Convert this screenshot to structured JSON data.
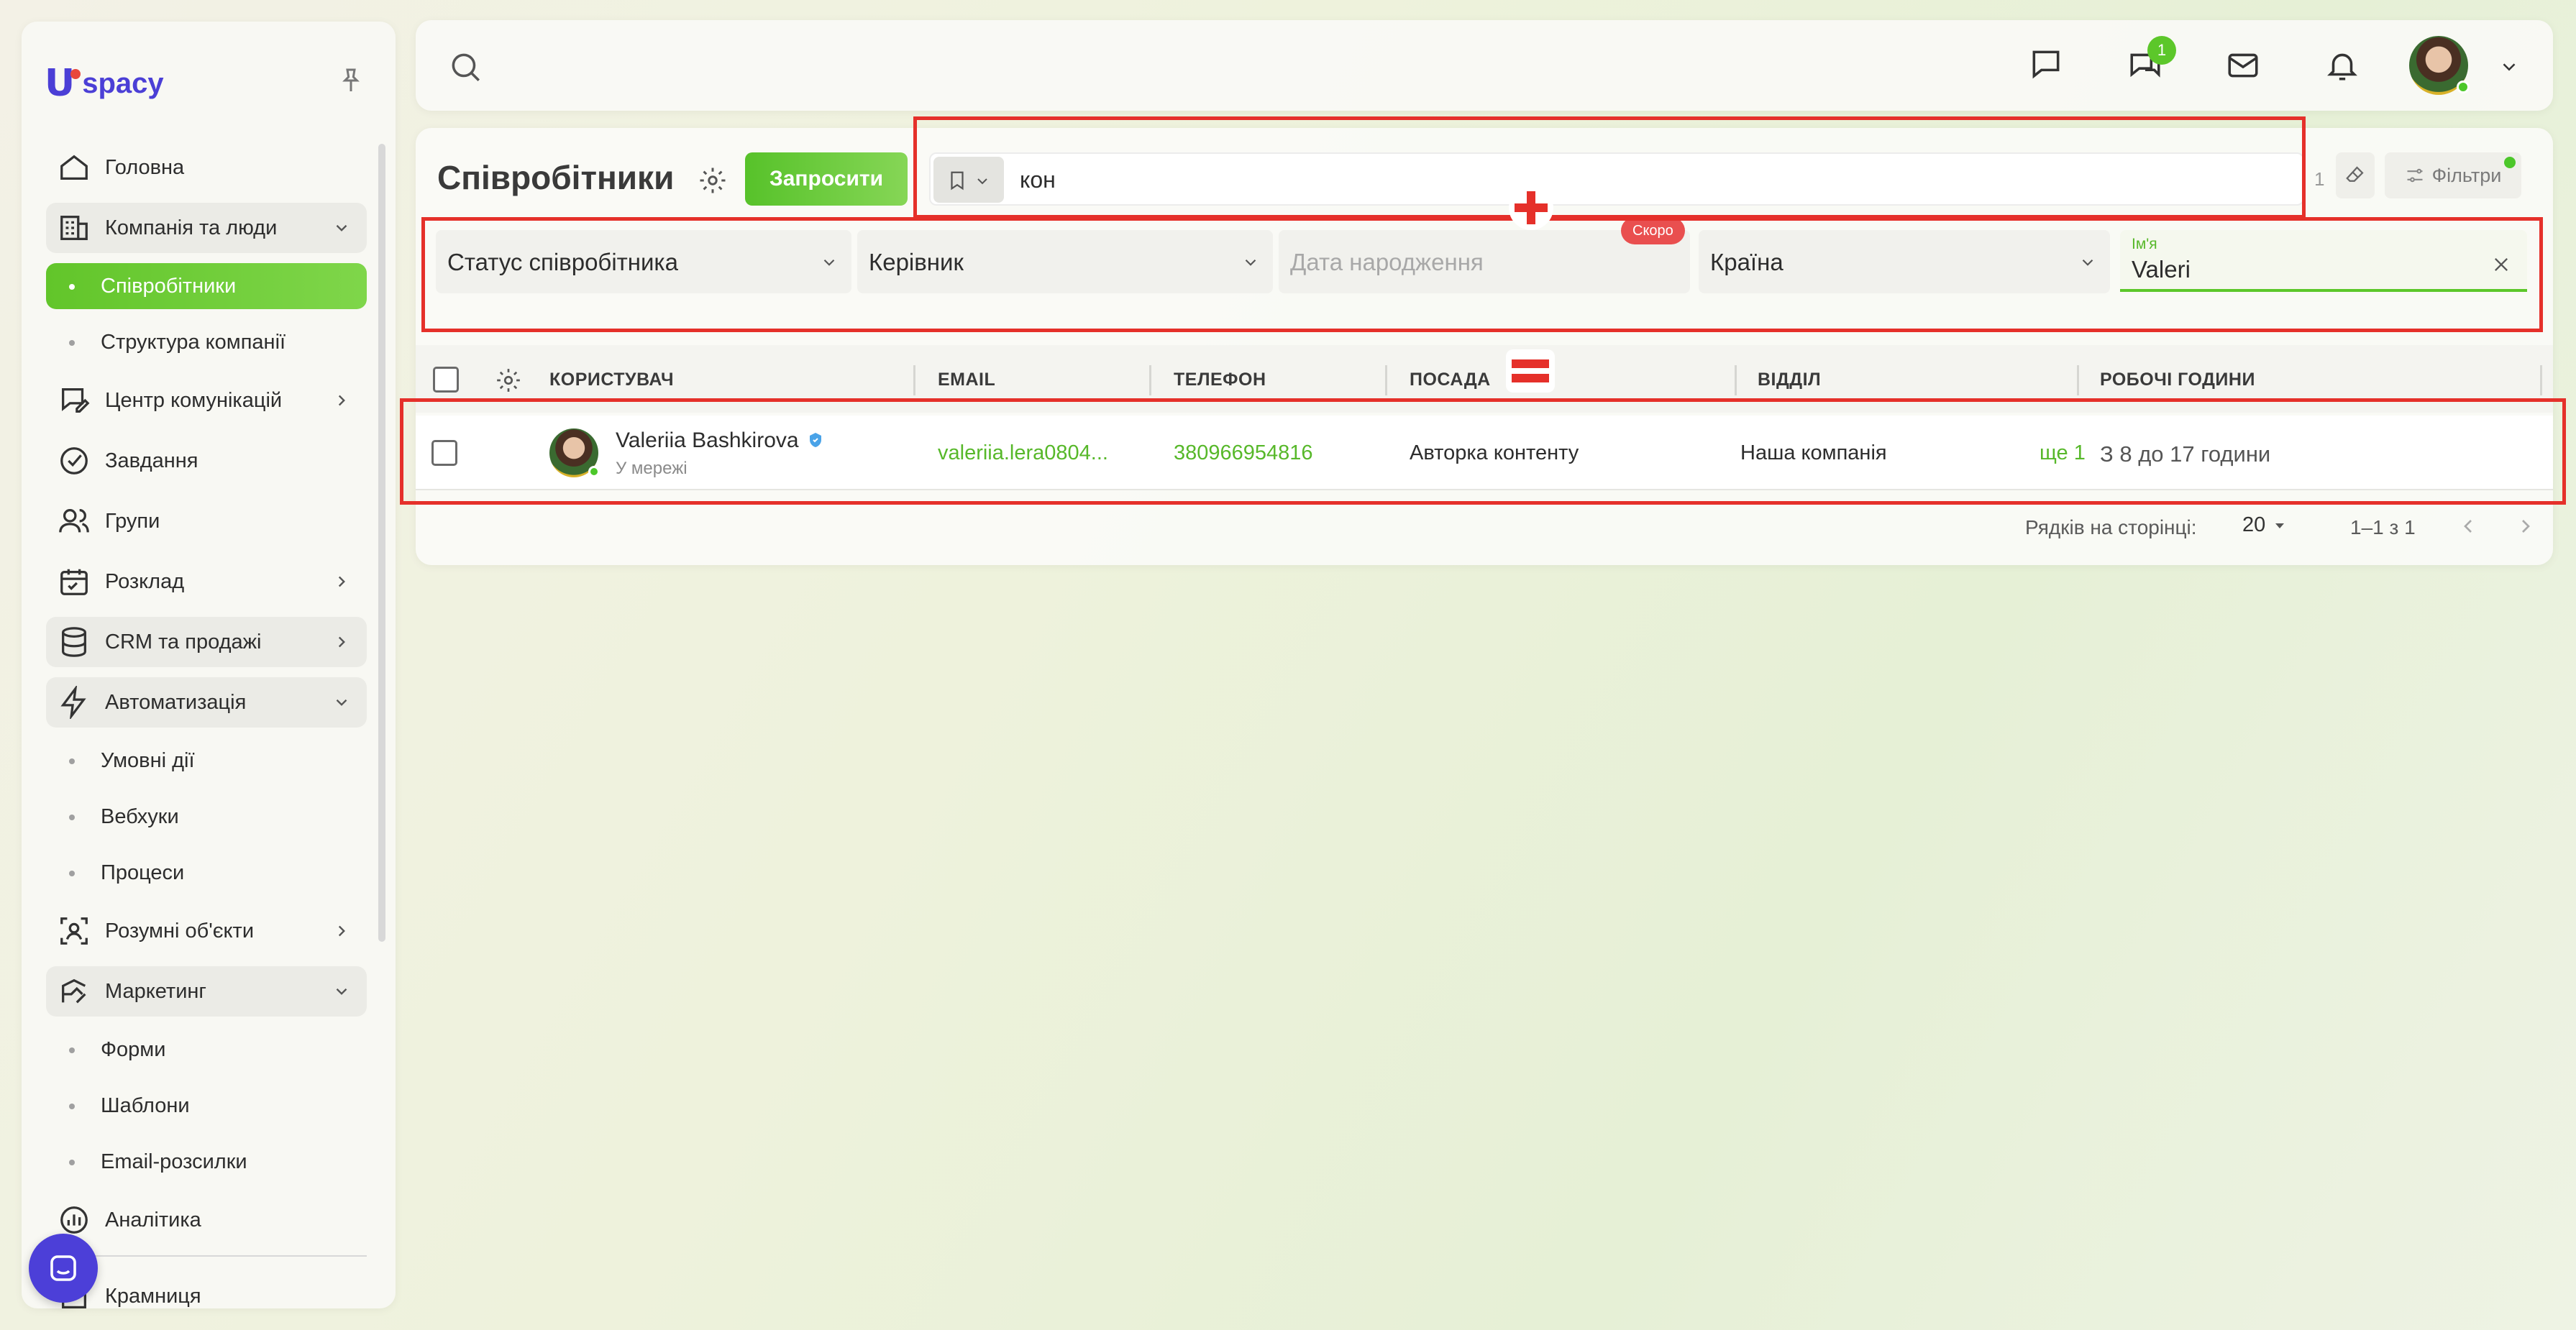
{
  "sidebar": {
    "logo_text": "spacy",
    "logo_letter": "U",
    "items": [
      {
        "label": "Головна",
        "icon": "home-icon"
      },
      {
        "label": "Компанія та люди",
        "icon": "building-icon"
      },
      {
        "label": "Співробітники",
        "icon": "dot"
      },
      {
        "label": "Структура компанії",
        "icon": "dot"
      },
      {
        "label": "Центр комунікацій",
        "icon": "chat-edit-icon"
      },
      {
        "label": "Завдання",
        "icon": "check-circle-icon"
      },
      {
        "label": "Групи",
        "icon": "users-icon"
      },
      {
        "label": "Розклад",
        "icon": "calendar-icon"
      },
      {
        "label": "CRM та продажі",
        "icon": "database-icon"
      },
      {
        "label": "Автоматизація",
        "icon": "lightning-icon"
      },
      {
        "label": "Умовні дії",
        "icon": "dot"
      },
      {
        "label": "Вебхуки",
        "icon": "dot"
      },
      {
        "label": "Процеси",
        "icon": "dot"
      },
      {
        "label": "Розумні об'єкти",
        "icon": "scan-icon"
      },
      {
        "label": "Маркетинг",
        "icon": "marketing-icon"
      },
      {
        "label": "Форми",
        "icon": "dot"
      },
      {
        "label": "Шаблони",
        "icon": "dot"
      },
      {
        "label": "Email-розсилки",
        "icon": "dot"
      },
      {
        "label": "Аналітика",
        "icon": "analytics-icon"
      },
      {
        "label": "Крамниця",
        "icon": "store-icon"
      }
    ]
  },
  "header": {
    "chat_badge": "1"
  },
  "page": {
    "title": "Співробітники",
    "invite_label": "Запросити",
    "search_value": "кон",
    "count": "1",
    "filters_label": "Фільтри"
  },
  "filters": {
    "status": "Статус співробітника",
    "manager": "Керівник",
    "birthday": "Дата народження",
    "soon_badge": "Скоро",
    "country": "Країна",
    "name_label": "Ім'я",
    "name_value": "Valeri"
  },
  "table": {
    "columns": [
      "КОРИСТУВАЧ",
      "EMAIL",
      "ТЕЛЕФОН",
      "ПОСАДА",
      "ВІДДІЛ",
      "РОБОЧІ ГОДИНИ"
    ],
    "rows": [
      {
        "name": "Valeriia Bashkirova",
        "status": "У мережі",
        "email": "valeriia.lera0804...",
        "phone": "380966954816",
        "position": "Авторка контенту",
        "department": "Наша компанія",
        "more": "ще 1",
        "hours": "З 8 до 17 години"
      }
    ]
  },
  "pagination": {
    "rows_label": "Рядків на сторінці:",
    "rows_value": "20",
    "range": "1–1 з 1"
  },
  "colors": {
    "accent": "#5cc72a",
    "brand": "#4b3fd6",
    "annotation": "#e5302a"
  }
}
